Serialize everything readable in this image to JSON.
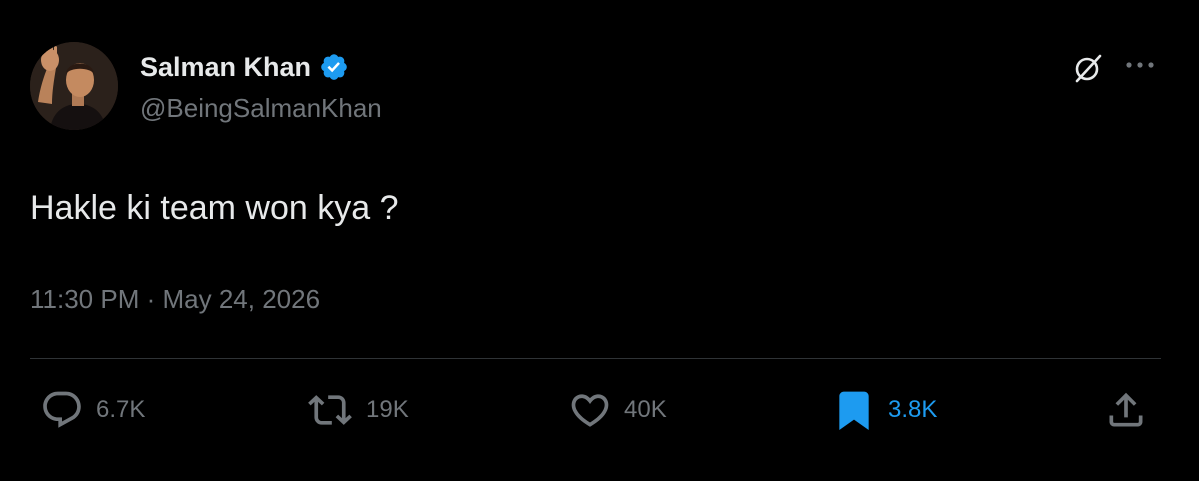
{
  "user": {
    "display_name": "Salman Khan",
    "handle": "@BeingSalmanKhan",
    "verified": true
  },
  "tweet": {
    "text": "Hakle ki team won kya ?",
    "time": "11:30 PM",
    "separator": "·",
    "date": "May 24, 2026"
  },
  "actions": {
    "replies": "6.7K",
    "reposts": "19K",
    "likes": "40K",
    "bookmarks": "3.8K"
  },
  "colors": {
    "background": "#000000",
    "text_primary": "#e7e9ea",
    "text_secondary": "#71767b",
    "accent": "#1d9bf0",
    "divider": "#2f3336"
  },
  "icons": {
    "verified": "verified-badge-icon",
    "grok": "grok-icon",
    "more": "more-icon",
    "reply": "reply-icon",
    "repost": "repost-icon",
    "like": "heart-icon",
    "bookmark": "bookmark-icon",
    "share": "share-icon"
  }
}
